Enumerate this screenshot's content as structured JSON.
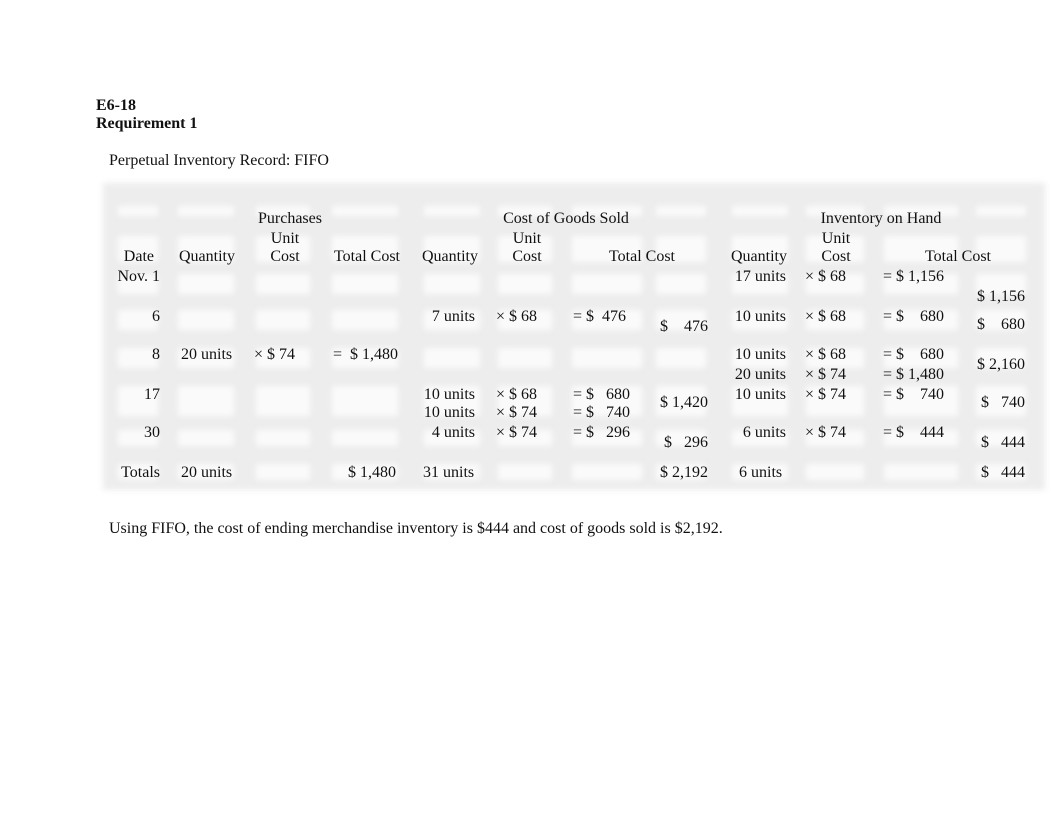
{
  "heading": {
    "exercise": "E6-18",
    "requirement": "Requirement 1",
    "record_title": "Perpetual Inventory Record:  FIFO"
  },
  "table": {
    "groups": {
      "purchases": "Purchases",
      "cogs": "Cost of Goods Sold",
      "inventory": "Inventory on Hand"
    },
    "columns": {
      "date": "Date",
      "p_qty": "Quantity",
      "p_unit_1": "Unit",
      "p_unit_2": "Cost",
      "p_total": "Total Cost",
      "c_qty": "Quantity",
      "c_unit_1": "Unit",
      "c_unit_2": "Cost",
      "c_total": "Total Cost",
      "i_qty": "Quantity",
      "i_unit_1": "Unit",
      "i_unit_2": "Cost",
      "i_total": "Total Cost"
    },
    "rows": [
      {
        "date": "Nov. 1",
        "purchase": null,
        "cogs_lines": [],
        "cogs_total": "",
        "inv_lines": [
          {
            "qty": "17 units",
            "unit": "× $ 68",
            "total": "= $ 1,156"
          }
        ],
        "inv_total": "$ 1,156"
      },
      {
        "date": "6",
        "purchase": null,
        "cogs_lines": [
          {
            "qty": "7 units",
            "unit": "× $ 68",
            "total": "= $  476"
          }
        ],
        "cogs_total": "$    476",
        "inv_lines": [
          {
            "qty": "10 units",
            "unit": "× $ 68",
            "total": "= $    680"
          }
        ],
        "inv_total": "$    680"
      },
      {
        "date": "8",
        "purchase": {
          "qty": "20 units",
          "unit": "× $ 74",
          "total": "=  $ 1,480"
        },
        "cogs_lines": [],
        "cogs_total": "",
        "inv_lines": [
          {
            "qty": "10 units",
            "unit": "× $ 68",
            "total": "= $    680"
          },
          {
            "qty": "20 units",
            "unit": "× $ 74",
            "total": "= $ 1,480"
          }
        ],
        "inv_total": "$ 2,160"
      },
      {
        "date": "17",
        "purchase": null,
        "cogs_lines": [
          {
            "qty": "10 units",
            "unit": "× $ 68",
            "total": "= $   680"
          },
          {
            "qty": "10 units",
            "unit": "× $ 74",
            "total": "= $   740"
          }
        ],
        "cogs_total": "$ 1,420",
        "inv_lines": [
          {
            "qty": "10 units",
            "unit": "× $ 74",
            "total": "= $    740"
          }
        ],
        "inv_total": "$   740"
      },
      {
        "date": "30",
        "purchase": null,
        "cogs_lines": [
          {
            "qty": "4 units",
            "unit": "× $ 74",
            "total": "= $   296"
          }
        ],
        "cogs_total": "$   296",
        "inv_lines": [
          {
            "qty": "6 units",
            "unit": "× $ 74",
            "total": "= $    444"
          }
        ],
        "inv_total": "$   444"
      }
    ],
    "totals": {
      "label": "Totals",
      "p_qty": "20 units",
      "p_total": "$ 1,480",
      "c_qty": "31 units",
      "c_total": "$ 2,192",
      "i_qty": "6 units",
      "i_total": "$   444"
    }
  },
  "conclusion": "Using FIFO, the cost of ending merchandise inventory is $444 and cost of goods sold is $2,192."
}
